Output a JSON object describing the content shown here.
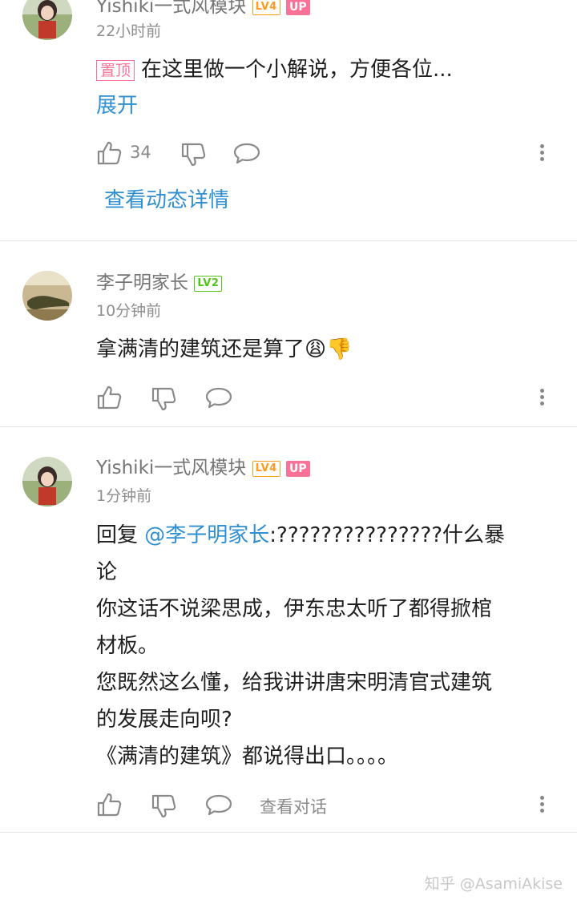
{
  "comments": [
    {
      "username": "Yishiki一式风模块",
      "level": "LV4",
      "up_badge": "UP",
      "time": "22小时前",
      "pin_tag": "置顶",
      "text": "在这里做一个小解说，方便各位...",
      "expand_label": "展开",
      "like_count": "34",
      "view_dynamic_label": "查看动态详情"
    },
    {
      "username": "李子明家长",
      "level": "LV2",
      "time": "10分钟前",
      "text": "拿满清的建筑还是算了",
      "emoji": "😩👎"
    },
    {
      "username": "Yishiki一式风模块",
      "level": "LV4",
      "up_badge": "UP",
      "time": "1分钟前",
      "reply_prefix": "回复 ",
      "mention": "@李子明家长",
      "lines": [
        ":???????????????什么暴",
        "论",
        "你这话不说梁思成，伊东忠太听了都得掀棺",
        "材板。",
        "您既然这么懂，给我讲讲唐宋明清官式建筑",
        "的发展走向呗?",
        "《满清的建筑》都说得出口。。。。"
      ],
      "view_conversation_label": "查看对话"
    }
  ],
  "watermark": "知乎 @AsamiAkise",
  "icons": [
    "thumbs-up-icon",
    "thumbs-down-icon",
    "comment-bubble-icon",
    "more-vertical-icon"
  ],
  "colors": {
    "link": "#2f8fd0",
    "pink": "#fb7299",
    "lv2": "#52c41a",
    "lv4": "#ff9a1f"
  }
}
